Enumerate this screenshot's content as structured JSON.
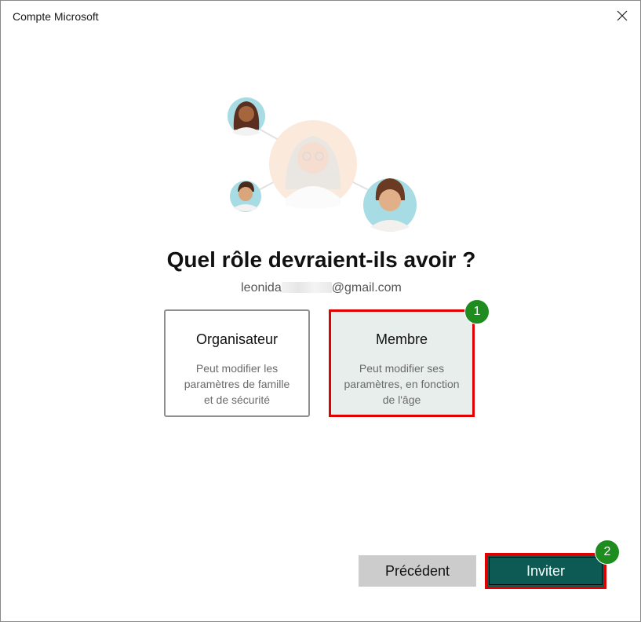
{
  "window": {
    "title": "Compte Microsoft",
    "close_glyph": "✕"
  },
  "heading": "Quel rôle devraient-ils avoir ?",
  "email": {
    "prefix": "leonida",
    "suffix": "@gmail.com"
  },
  "roles": [
    {
      "title": "Organisateur",
      "description": "Peut modifier les paramètres de famille et de sécurité",
      "selected": false
    },
    {
      "title": "Membre",
      "description": "Peut modifier ses paramètres, en fonction de l'âge",
      "selected": true
    }
  ],
  "annotations": {
    "badge_1": "1",
    "badge_2": "2",
    "highlight_color": "#e00000",
    "badge_color": "#1e8c1e"
  },
  "buttons": {
    "previous": "Précédent",
    "invite": "Inviter"
  },
  "icons": {
    "close": "close-icon",
    "illustration": "family-avatars-illustration"
  },
  "colors": {
    "invite_bg": "#0c5a53",
    "previous_bg": "#cccccc",
    "selected_card_bg": "#e7eeec"
  }
}
